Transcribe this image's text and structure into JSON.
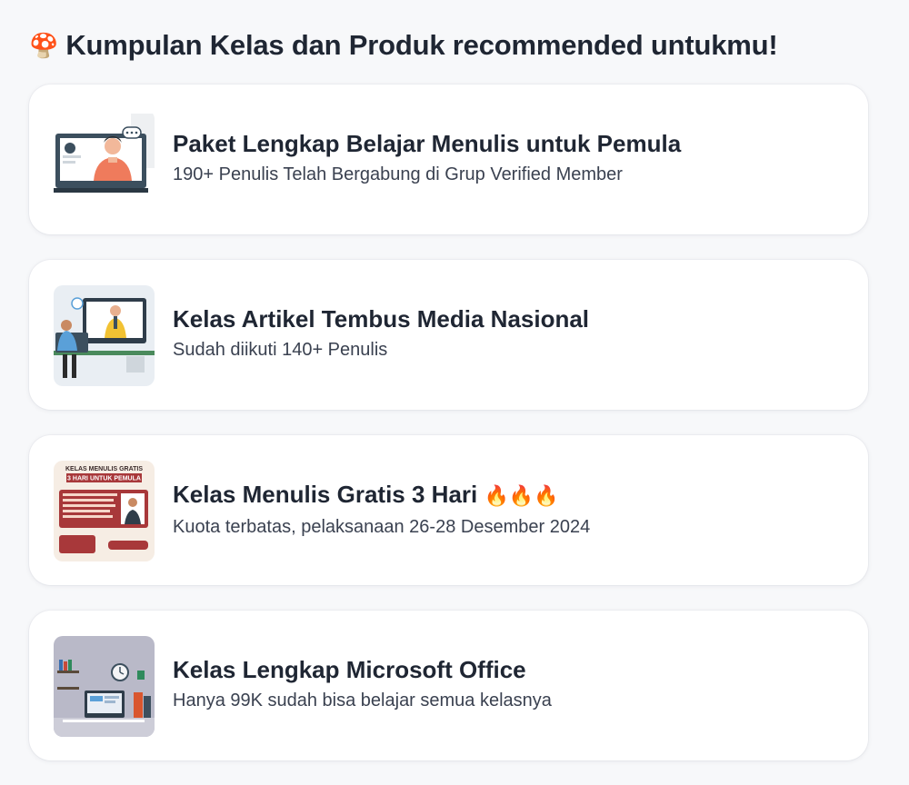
{
  "section": {
    "emoji": "🍄",
    "title": "Kumpulan Kelas dan Produk recommended untukmu!"
  },
  "cards": [
    {
      "title": "Paket Lengkap Belajar Menulis untuk Pemula",
      "subtitle": "190+ Penulis Telah Bergabung di Grup Verified Member",
      "thumb_icon": "video-call-illustration"
    },
    {
      "title": "Kelas Artikel Tembus Media Nasional",
      "subtitle": "Sudah diikuti 140+ Penulis",
      "thumb_icon": "online-class-illustration"
    },
    {
      "title": "Kelas Menulis Gratis 3 Hari",
      "title_emoji": "🔥🔥🔥",
      "subtitle": "Kuota terbatas, pelaksanaan 26-28 Desember 2024",
      "thumb_icon": "free-class-poster",
      "poster": {
        "headline": "KELAS MENULIS GRATIS",
        "banner": "3 HARI UNTUK PEMULA"
      }
    },
    {
      "title": "Kelas Lengkap Microsoft Office",
      "subtitle": "Hanya 99K sudah bisa belajar semua kelasnya",
      "thumb_icon": "office-desk-illustration"
    }
  ]
}
